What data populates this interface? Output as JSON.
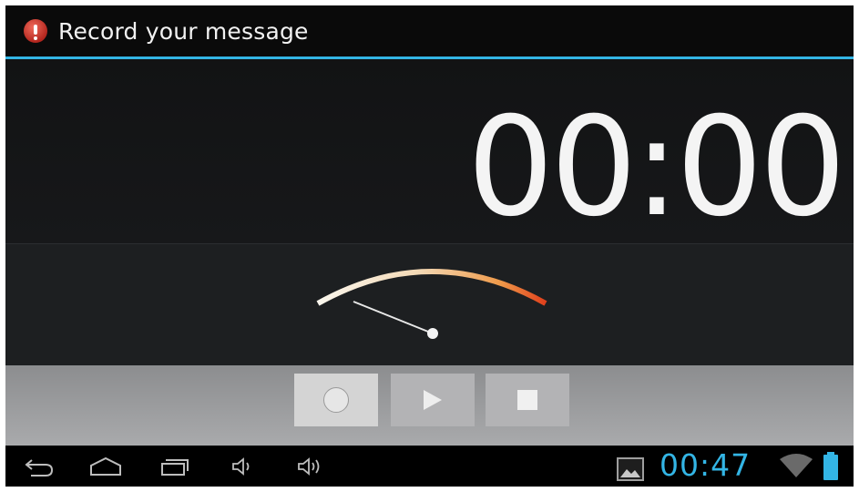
{
  "titlebar": {
    "title": "Record your message",
    "icon": "alert-icon",
    "accent_color": "#33b5e5"
  },
  "recorder": {
    "elapsed_time": "00:00",
    "level_meter": {
      "level": 0.0
    }
  },
  "controls": {
    "record_icon": "record-icon",
    "play_icon": "play-icon",
    "stop_icon": "stop-icon",
    "selected": "record"
  },
  "system_bar": {
    "nav_icons": [
      "back-icon",
      "home-icon",
      "recent-apps-icon",
      "volume-down-icon",
      "volume-up-icon"
    ],
    "status_icons": [
      "gallery-notification-icon",
      "wifi-icon",
      "battery-icon"
    ],
    "clock": "00:47",
    "clock_color": "#33b5e5"
  }
}
